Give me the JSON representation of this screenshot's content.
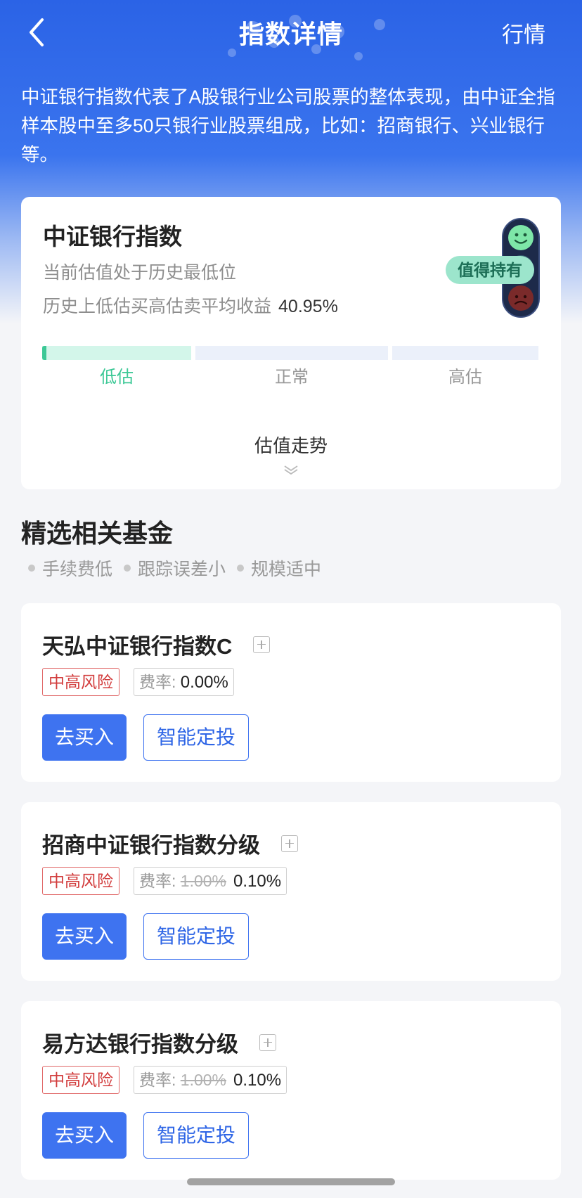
{
  "nav": {
    "title": "指数详情",
    "right_label": "行情"
  },
  "intro": "中证银行指数代表了A股银行业公司股票的整体表现，由中证全指样本股中至多50只银行业股票组成，比如：招商银行、兴业银行等。",
  "index_card": {
    "title": "中证银行指数",
    "status": "当前估值处于历史最低位",
    "avg_return_label": "历史上低估买高估卖平均收益",
    "avg_return": "40.95%",
    "badge": "值得持有",
    "gauge": {
      "low": "低估",
      "normal": "正常",
      "high": "高估",
      "current_zone": "低估"
    },
    "trend_label": "估值走势"
  },
  "funds_section": {
    "title": "精选相关基金",
    "tags": [
      "手续费低",
      "跟踪误差小",
      "规模适中"
    ]
  },
  "funds": [
    {
      "name": "天弘中证银行指数C",
      "risk": "中高风险",
      "fee_label": "费率:",
      "fee_old": "",
      "fee_now": "0.00%",
      "buy": "去买入",
      "sip": "智能定投"
    },
    {
      "name": "招商中证银行指数分级",
      "risk": "中高风险",
      "fee_label": "费率:",
      "fee_old": "1.00%",
      "fee_now": "0.10%",
      "buy": "去买入",
      "sip": "智能定投"
    },
    {
      "name": "易方达银行指数分级",
      "risk": "中高风险",
      "fee_label": "费率:",
      "fee_old": "1.00%",
      "fee_now": "0.10%",
      "buy": "去买入",
      "sip": "智能定投"
    }
  ],
  "colors": {
    "primary": "#3e73f0",
    "low_zone": "#3cc896",
    "risk": "#d23c3c"
  }
}
